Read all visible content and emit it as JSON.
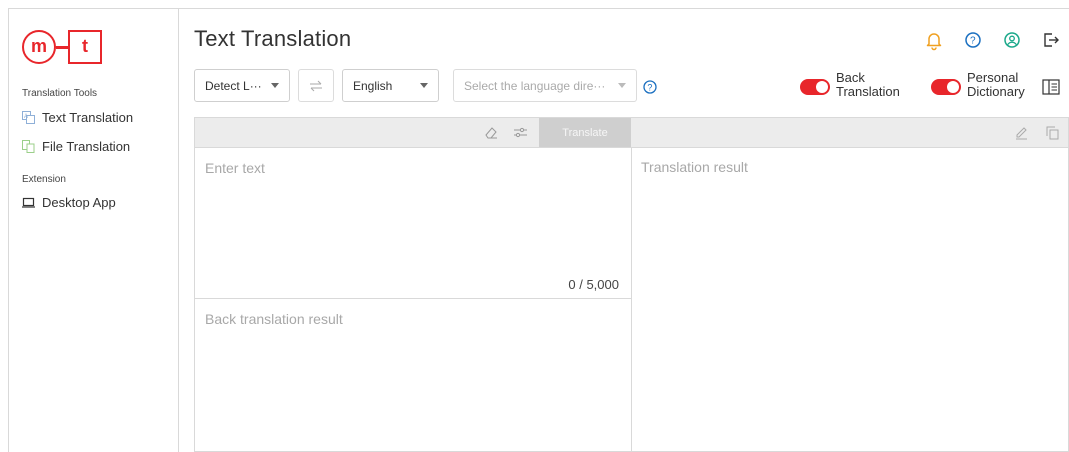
{
  "app": {
    "logo_left": "m",
    "logo_right": "t",
    "page_title": "Text Translation"
  },
  "sidebar": {
    "section_tools": "Translation Tools",
    "items": [
      {
        "label": "Text Translation",
        "icon": "text-translate-icon"
      },
      {
        "label": "File Translation",
        "icon": "file-translate-icon"
      }
    ],
    "section_extension": "Extension",
    "extension_items": [
      {
        "label": "Desktop App",
        "icon": "laptop-icon"
      }
    ]
  },
  "header_icons": [
    "bell-icon",
    "help-icon",
    "account-icon",
    "logout-icon"
  ],
  "toolbar": {
    "source_lang": "Detect L···",
    "swap_icon": "swap-icon",
    "target_lang": "English",
    "direction_placeholder": "Select the language dire···",
    "back_translation_label_1": "Back",
    "back_translation_label_2": "Translation",
    "personal_dictionary_label_1": "Personal",
    "personal_dictionary_label_2": "Dictionary",
    "back_translation_on": true,
    "personal_dictionary_on": true
  },
  "editor": {
    "translate_button": "Translate",
    "input_placeholder": "Enter text",
    "char_count": "0 / 5,000",
    "back_translation_placeholder": "Back translation result",
    "result_placeholder": "Translation result"
  },
  "colors": {
    "accent": "#e8262b",
    "bell": "#f0a020",
    "help": "#1a6fc0",
    "account": "#1aa88a"
  }
}
